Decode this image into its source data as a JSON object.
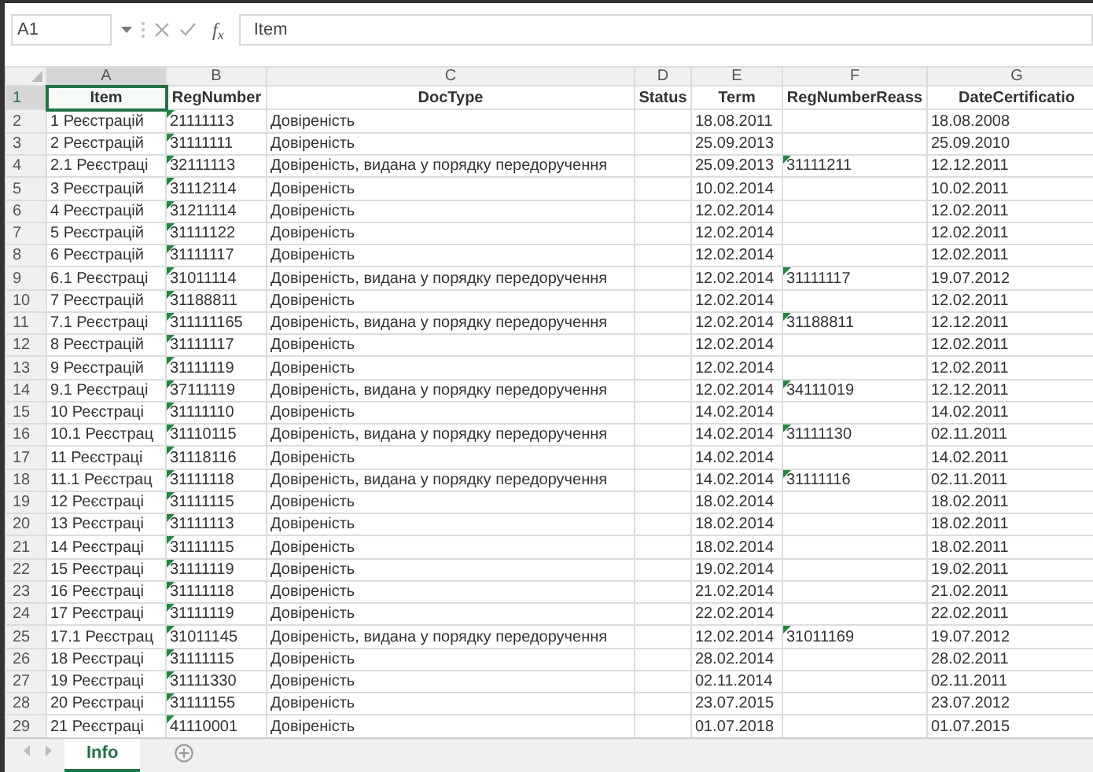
{
  "formula_bar": {
    "name_box": "A1",
    "function_label": "f$_{x}$",
    "formula": "Item"
  },
  "columns": [
    {
      "letter": "A",
      "selected": true
    },
    {
      "letter": "B",
      "selected": false
    },
    {
      "letter": "C",
      "selected": false
    },
    {
      "letter": "D",
      "selected": false
    },
    {
      "letter": "E",
      "selected": false
    },
    {
      "letter": "F",
      "selected": false
    },
    {
      "letter": "G",
      "selected": false
    }
  ],
  "header_row": {
    "row": "1",
    "selected": true,
    "cells": [
      {
        "text": "Item",
        "selected": true
      },
      {
        "text": "RegNumber",
        "selected": false
      },
      {
        "text": "DocType",
        "selected": false
      },
      {
        "text": "Status",
        "selected": false
      },
      {
        "text": "Term",
        "selected": false
      },
      {
        "text": "RegNumberReass",
        "selected": false
      },
      {
        "text": "DateCertificatio",
        "selected": false
      }
    ]
  },
  "rows": [
    {
      "row": "2",
      "item": "1 Реєстрацій",
      "reg_number": "21111113",
      "reg_flagged": true,
      "doc_type": "Довіреність",
      "term": "18.08.2011",
      "date": "18.08.2008"
    },
    {
      "row": "3",
      "item": "2 Реєстрацій",
      "reg_number": "31111111",
      "reg_flagged": true,
      "doc_type": "Довіреність",
      "term": "25.09.2013",
      "date": "25.09.2010"
    },
    {
      "row": "4",
      "item": "2.1 Реєстраці",
      "reg_number": "32111113",
      "reg_flagged": true,
      "doc_type": "Довіреність, видана у порядку передоручення",
      "term": "25.09.2013",
      "reass": "31111211",
      "reass_flagged": true,
      "date": "12.12.2011"
    },
    {
      "row": "5",
      "item": "3 Реєстрацій",
      "reg_number": "31112114",
      "reg_flagged": true,
      "doc_type": "Довіреність",
      "term": "10.02.2014",
      "date": "10.02.2011"
    },
    {
      "row": "6",
      "item": "4 Реєстрацій",
      "reg_number": "31211114",
      "reg_flagged": true,
      "doc_type": "Довіреність",
      "term": "12.02.2014",
      "date": "12.02.2011"
    },
    {
      "row": "7",
      "item": "5 Реєстрацій",
      "reg_number": "31111122",
      "reg_flagged": true,
      "doc_type": "Довіреність",
      "term": "12.02.2014",
      "date": "12.02.2011"
    },
    {
      "row": "8",
      "item": "6 Реєстрацій",
      "reg_number": "31111117",
      "reg_flagged": true,
      "doc_type": "Довіреність",
      "term": "12.02.2014",
      "date": "12.02.2011"
    },
    {
      "row": "9",
      "item": "6.1 Реєстраці",
      "reg_number": "31011114",
      "reg_flagged": true,
      "doc_type": "Довіреність, видана у порядку передоручення",
      "term": "12.02.2014",
      "reass": "31111117",
      "reass_flagged": true,
      "date": "19.07.2012"
    },
    {
      "row": "10",
      "item": "7 Реєстрацій",
      "reg_number": "31188811",
      "reg_flagged": true,
      "doc_type": "Довіреність",
      "term": "12.02.2014",
      "date": "12.02.2011"
    },
    {
      "row": "11",
      "item": "7.1 Реєстраці",
      "reg_number": "311111165",
      "reg_flagged": true,
      "doc_type": "Довіреність, видана у порядку передоручення",
      "term": "12.02.2014",
      "reass": "31188811",
      "reass_flagged": true,
      "date": "12.12.2011"
    },
    {
      "row": "12",
      "item": "8 Реєстрацій",
      "reg_number": "31111117",
      "reg_flagged": true,
      "doc_type": "Довіреність",
      "term": "12.02.2014",
      "date": "12.02.2011"
    },
    {
      "row": "13",
      "item": "9 Реєстрацій",
      "reg_number": "31111119",
      "reg_flagged": true,
      "doc_type": "Довіреність",
      "term": "12.02.2014",
      "date": "12.02.2011"
    },
    {
      "row": "14",
      "item": "9.1 Реєстраці",
      "reg_number": "37111119",
      "reg_flagged": true,
      "doc_type": "Довіреність, видана у порядку передоручення",
      "term": "12.02.2014",
      "reass": "34111019",
      "reass_flagged": true,
      "date": "12.12.2011"
    },
    {
      "row": "15",
      "item": "10 Реєстраці",
      "reg_number": "31111110",
      "reg_flagged": true,
      "doc_type": "Довіреність",
      "term": "14.02.2014",
      "date": "14.02.2011"
    },
    {
      "row": "16",
      "item": "10.1 Реєстрац",
      "reg_number": "31110115",
      "reg_flagged": true,
      "doc_type": "Довіреність, видана у порядку передоручення",
      "term": "14.02.2014",
      "reass": "31111130",
      "reass_flagged": true,
      "date": "02.11.2011"
    },
    {
      "row": "17",
      "item": "11 Реєстраці",
      "reg_number": "31118116",
      "reg_flagged": true,
      "doc_type": "Довіреність",
      "term": "14.02.2014",
      "date": "14.02.2011"
    },
    {
      "row": "18",
      "item": "11.1 Реєстрац",
      "reg_number": "31111118",
      "reg_flagged": true,
      "doc_type": "Довіреність, видана у порядку передоручення",
      "term": "14.02.2014",
      "reass": "31111116",
      "reass_flagged": true,
      "date": "02.11.2011"
    },
    {
      "row": "19",
      "item": "12 Реєстраці",
      "reg_number": "31111115",
      "reg_flagged": true,
      "doc_type": "Довіреність",
      "term": "18.02.2014",
      "date": "18.02.2011"
    },
    {
      "row": "20",
      "item": "13 Реєстраці",
      "reg_number": "31111113",
      "reg_flagged": true,
      "doc_type": "Довіреність",
      "term": "18.02.2014",
      "date": "18.02.2011"
    },
    {
      "row": "21",
      "item": "14 Реєстраці",
      "reg_number": "31111115",
      "reg_flagged": true,
      "doc_type": "Довіреність",
      "term": "18.02.2014",
      "date": "18.02.2011"
    },
    {
      "row": "22",
      "item": "15 Реєстраці",
      "reg_number": "31111119",
      "reg_flagged": true,
      "doc_type": "Довіреність",
      "term": "19.02.2014",
      "date": "19.02.2011"
    },
    {
      "row": "23",
      "item": "16 Реєстраці",
      "reg_number": "31111118",
      "reg_flagged": true,
      "doc_type": "Довіреність",
      "term": "21.02.2014",
      "date": "21.02.2011"
    },
    {
      "row": "24",
      "item": "17 Реєстраці",
      "reg_number": "31111119",
      "reg_flagged": true,
      "doc_type": "Довіреність",
      "term": "22.02.2014",
      "date": "22.02.2011"
    },
    {
      "row": "25",
      "item": "17.1 Реєстрац",
      "reg_number": "31011145",
      "reg_flagged": true,
      "doc_type": "Довіреність, видана у порядку передоручення",
      "term": "12.02.2014",
      "reass": "31011169",
      "reass_flagged": true,
      "date": "19.07.2012"
    },
    {
      "row": "26",
      "item": "18 Реєстраці",
      "reg_number": "31111115",
      "reg_flagged": true,
      "doc_type": "Довіреність",
      "term": "28.02.2014",
      "date": "28.02.2011"
    },
    {
      "row": "27",
      "item": "19 Реєстраці",
      "reg_number": "31111330",
      "reg_flagged": true,
      "doc_type": "Довіреність",
      "term": "02.11.2014",
      "date": "02.11.2011"
    },
    {
      "row": "28",
      "item": "20 Реєстраці",
      "reg_number": "31111155",
      "reg_flagged": true,
      "doc_type": "Довіреність",
      "term": "23.07.2015",
      "date": "23.07.2012"
    },
    {
      "row": "29",
      "item": "21 Реєстраці",
      "reg_number": "41110001",
      "reg_flagged": true,
      "doc_type": "Довіреність",
      "term": "01.07.2018",
      "date": "01.07.2015"
    }
  ],
  "sheet_tabs": [
    {
      "label": "Info",
      "selected": true
    }
  ]
}
